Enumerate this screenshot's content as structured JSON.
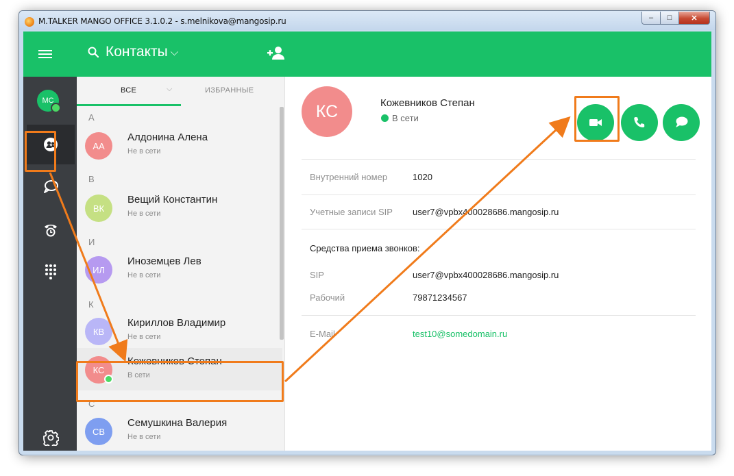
{
  "window": {
    "title": "M.TALKER MANGO OFFICE 3.1.0.2 - s.melnikova@mangosip.ru",
    "min_label": "–",
    "max_label": "□",
    "close_label": "✕"
  },
  "header": {
    "title": "Контакты",
    "dropdown_icon": "chevron-down-icon",
    "search_icon": "search-icon",
    "menu_icon": "hamburger-menu-icon",
    "add_contact_icon": "add-contact-icon"
  },
  "rail": {
    "avatar_initials": "МС",
    "items": [
      "contacts-icon",
      "chats-icon",
      "call-history-icon",
      "dialpad-icon"
    ],
    "settings_icon": "gear-icon"
  },
  "tabs": {
    "all": "ВСЕ",
    "favorites": "ИЗБРАННЫЕ"
  },
  "contact_list": {
    "groups": [
      {
        "letter": "А",
        "contacts": [
          {
            "initials": "АА",
            "name": "Алдонина Алена",
            "status": "Не в сети",
            "color": "#f28c8c"
          }
        ]
      },
      {
        "letter": "В",
        "contacts": [
          {
            "initials": "ВК",
            "name": "Вещий Константин",
            "status": "Не в сети",
            "color": "#c5e083"
          }
        ]
      },
      {
        "letter": "И",
        "contacts": [
          {
            "initials": "ИЛ",
            "name": "Иноземцев Лев",
            "status": "Не в сети",
            "color": "#b69af0"
          }
        ]
      },
      {
        "letter": "К",
        "contacts": [
          {
            "initials": "КВ",
            "name": "Кириллов Владимир",
            "status": "Не в сети",
            "color": "#b9b6f7"
          },
          {
            "initials": "КС",
            "name": "Кожевников Степан",
            "status": "В сети",
            "color": "#f28c8c"
          }
        ]
      },
      {
        "letter": "С",
        "contacts": [
          {
            "initials": "СВ",
            "name": "Семушкина Валерия",
            "status": "Не в сети",
            "color": "#7e9ef0"
          }
        ]
      }
    ]
  },
  "detail": {
    "initials": "КС",
    "name": "Кожевников Степан",
    "status": "В сети",
    "actions": [
      "video-call-icon",
      "phone-call-icon",
      "chat-icon"
    ],
    "internal_label": "Внутренний номер",
    "internal_value": "1020",
    "sip_label": "Учетные записи SIP",
    "sip_value": "user7@vpbx400028686.mangosip.ru",
    "means_title": "Средства приема звонков:",
    "means": [
      {
        "label": "SIP",
        "value": "user7@vpbx400028686.mangosip.ru"
      },
      {
        "label": "Рабочий",
        "value": "79871234567"
      }
    ],
    "email_label": "E-Mail",
    "email_value": "test10@somedomain.ru"
  },
  "colors": {
    "brand_green": "#19c168",
    "rail_dark": "#3b3e42",
    "annotation_orange": "#f07b1b",
    "online_dot": "#4cd964"
  }
}
